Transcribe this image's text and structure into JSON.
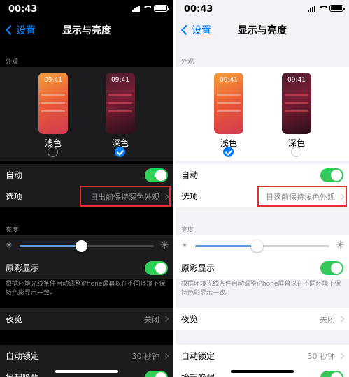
{
  "panels": {
    "dark": {
      "status": {
        "time": "00:43"
      },
      "nav": {
        "back": "设置",
        "title": "显示与亮度"
      },
      "appearance": {
        "header": "外观",
        "light": {
          "time": "09:41",
          "label": "浅色",
          "selected": false
        },
        "dark": {
          "time": "09:41",
          "label": "深色",
          "selected": true
        }
      },
      "automatic": {
        "label": "自动",
        "on": true
      },
      "options": {
        "label": "选项",
        "value": "日出前保持深色外观"
      },
      "brightness": {
        "header": "亮度",
        "level": 0.46
      },
      "true_tone": {
        "label": "原彩显示",
        "on": true
      },
      "true_tone_note": "根据环境光线条件自动调整iPhone屏幕以在不同环境下保持色彩显示一致。",
      "night_shift": {
        "label": "夜览",
        "value": "关闭"
      },
      "auto_lock": {
        "label": "自动锁定",
        "value": "30 秒钟"
      },
      "raise_to_wake": {
        "label": "抬起唤醒"
      }
    },
    "light": {
      "status": {
        "time": "00:43"
      },
      "nav": {
        "back": "设置",
        "title": "显示与亮度"
      },
      "appearance": {
        "header": "外观",
        "light": {
          "time": "09:41",
          "label": "浅色",
          "selected": true
        },
        "dark": {
          "time": "09:41",
          "label": "深色",
          "selected": false
        }
      },
      "automatic": {
        "label": "自动",
        "on": true
      },
      "options": {
        "label": "选项",
        "value": "日落前保持浅色外观"
      },
      "brightness": {
        "header": "亮度",
        "level": 0.46
      },
      "true_tone": {
        "label": "原彩显示",
        "on": true
      },
      "true_tone_note": "根据环境光线条件自动调整iPhone屏幕以在不同环境下保持色彩显示一致。",
      "night_shift": {
        "label": "夜览",
        "value": "关闭"
      },
      "auto_lock": {
        "label": "自动锁定",
        "value": "30 秒钟"
      },
      "raise_to_wake": {
        "label": "抬起唤醒"
      }
    }
  },
  "colors": {
    "accent_dark": "#0a84ff",
    "accent_light": "#007aff",
    "toggle_on": "#34c759",
    "highlight_box": "#e03030"
  },
  "icons": [
    "signal-icon",
    "wifi-icon",
    "battery-icon",
    "back-chevron-icon",
    "chevron-right-icon",
    "sun-small-icon",
    "sun-large-icon",
    "checkmark-icon"
  ]
}
